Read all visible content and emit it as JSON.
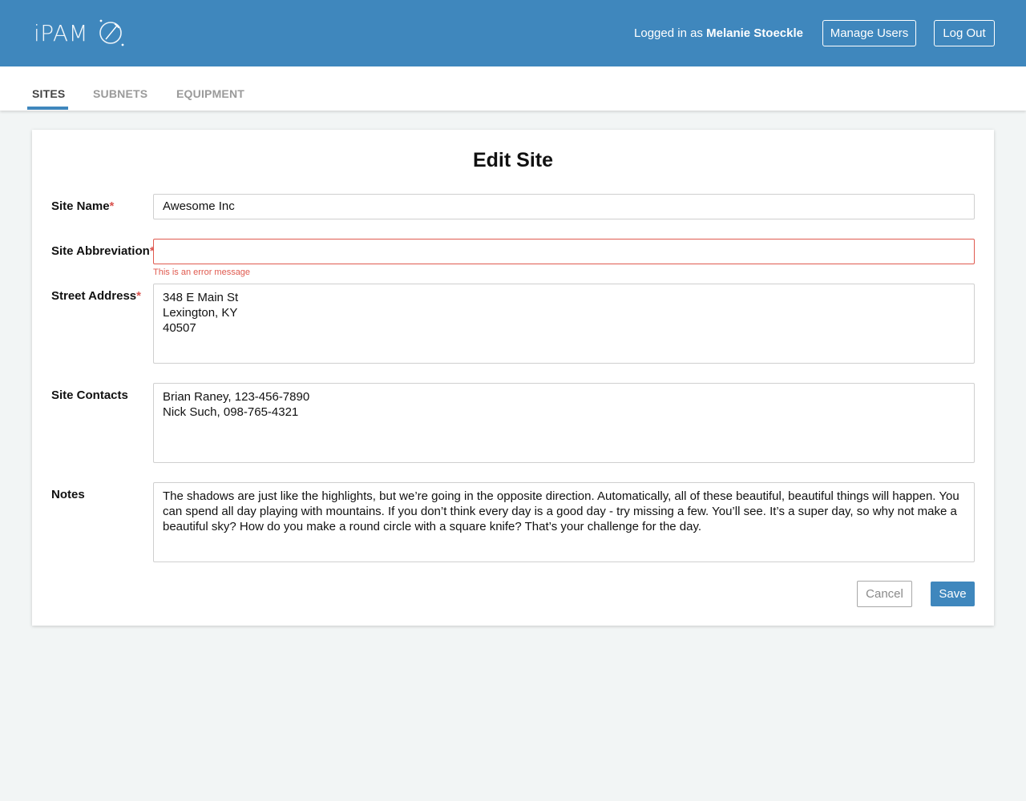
{
  "header": {
    "logo_text": "iPAM",
    "logged_in_prefix": "Logged in as",
    "user_name": "Melanie Stoeckle",
    "manage_users_label": "Manage Users",
    "logout_label": "Log Out"
  },
  "tabs": [
    {
      "label": "SITES",
      "active": true
    },
    {
      "label": "SUBNETS",
      "active": false
    },
    {
      "label": "EQUIPMENT",
      "active": false
    }
  ],
  "form": {
    "title": "Edit Site",
    "required_marker": "*",
    "site_name": {
      "label": "Site Name",
      "value": "Awesome Inc"
    },
    "site_abbreviation": {
      "label": "Site Abbreviation",
      "value": "",
      "error": "This is an error message"
    },
    "street_address": {
      "label": "Street Address",
      "value": "348 E Main St\nLexington, KY\n40507"
    },
    "site_contacts": {
      "label": "Site Contacts",
      "value": "Brian Raney, 123-456-7890\nNick Such, 098-765-4321"
    },
    "notes": {
      "label": "Notes",
      "value": "The shadows are just like the highlights, but we’re going in the opposite direction. Automatically, all of these beautiful, beautiful things will happen. You can spend all day playing with mountains. If you don’t think every day is a good day - try missing a few. You’ll see. It’s a super day, so why not make a beautiful sky? How do you make a round circle with a square knife? That’s your challenge for the day."
    },
    "cancel_label": "Cancel",
    "save_label": "Save"
  },
  "colors": {
    "brand_blue": "#3f87bd",
    "error_red": "#e05a4f",
    "page_bg": "#f2f5f5"
  },
  "icons": {
    "logo_mark": "orbit-rocket-icon"
  }
}
